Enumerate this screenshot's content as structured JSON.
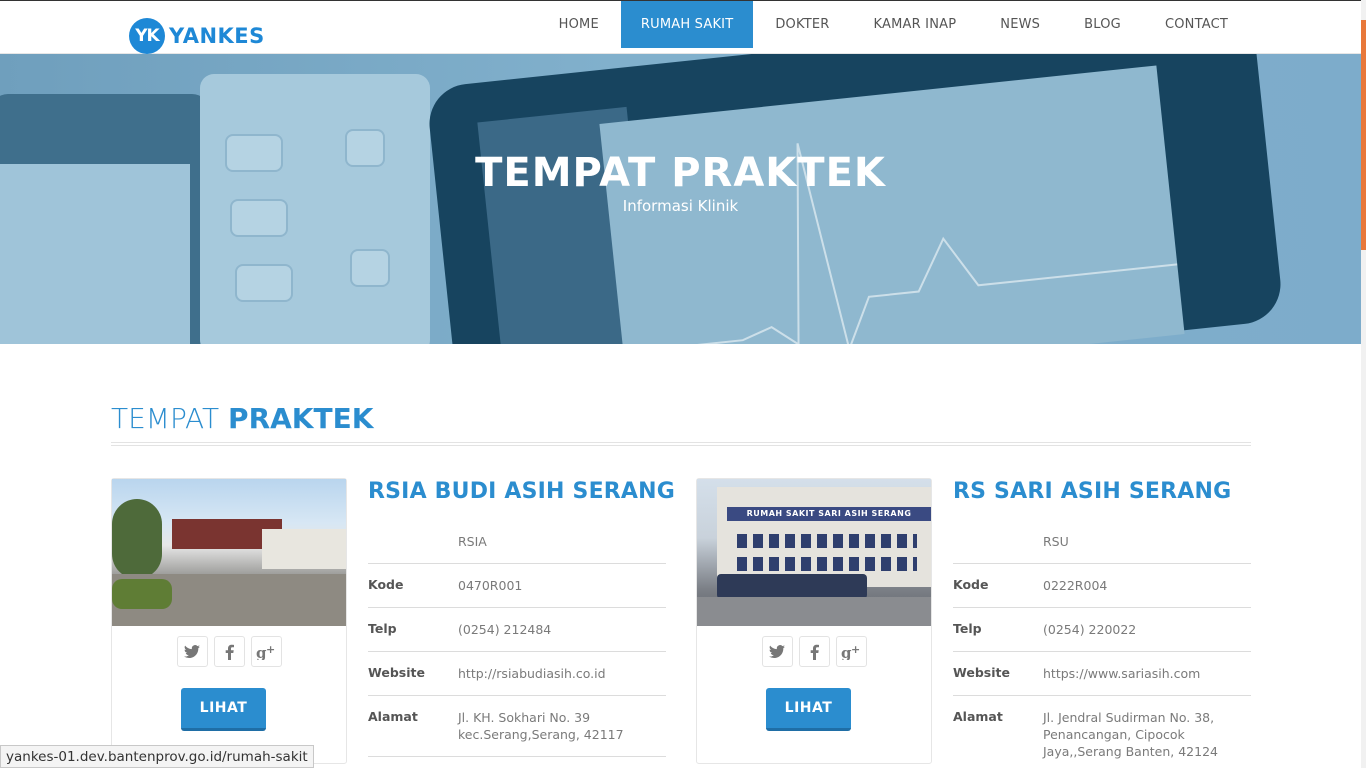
{
  "header": {
    "logo_mark": "YK",
    "logo_text": "YANKES",
    "nav": [
      {
        "label": "HOME"
      },
      {
        "label": "RUMAH SAKIT",
        "active": true
      },
      {
        "label": "DOKTER"
      },
      {
        "label": "KAMAR INAP"
      },
      {
        "label": "NEWS"
      },
      {
        "label": "BLOG"
      },
      {
        "label": "CONTACT"
      }
    ]
  },
  "hero": {
    "title": "TEMPAT PRAKTEK",
    "subtitle": "Informasi Klinik"
  },
  "section": {
    "title_light": "TEMPAT",
    "title_bold": "PRAKTEK"
  },
  "hospitals": [
    {
      "name": "RSIA BUDI ASIH SERANG",
      "type": "RSIA",
      "kode_label": "Kode",
      "kode": "0470R001",
      "telp_label": "Telp",
      "telp": "(0254) 212484",
      "website_label": "Website",
      "website": "http://rsiabudiasih.co.id",
      "alamat_label": "Alamat",
      "alamat": "Jl. KH. Sokhari No. 39 kec.Serang,Serang, 42117",
      "button": "LIHAT"
    },
    {
      "name": "RS SARI ASIH SERANG",
      "type": "RSU",
      "kode_label": "Kode",
      "kode": "0222R004",
      "telp_label": "Telp",
      "telp": "(0254) 220022",
      "website_label": "Website",
      "website": "https://www.sariasih.com",
      "alamat_label": "Alamat",
      "alamat": "Jl. Jendral Sudirman No. 38, Penancangan, Cipocok Jaya,,Serang Banten, 42124",
      "button": "LIHAT",
      "photo_sign": "RUMAH SAKIT SARI ASIH SERANG"
    }
  ],
  "social_icons": [
    "twitter-icon",
    "facebook-icon",
    "google-plus-icon"
  ],
  "statusbar": {
    "url": "yankes-01.dev.bantenprov.go.id/rumah-sakit"
  },
  "colors": {
    "brand": "#2b8dcf",
    "logo": "#1e88d6",
    "scroll_thumb": "#e8783a"
  }
}
